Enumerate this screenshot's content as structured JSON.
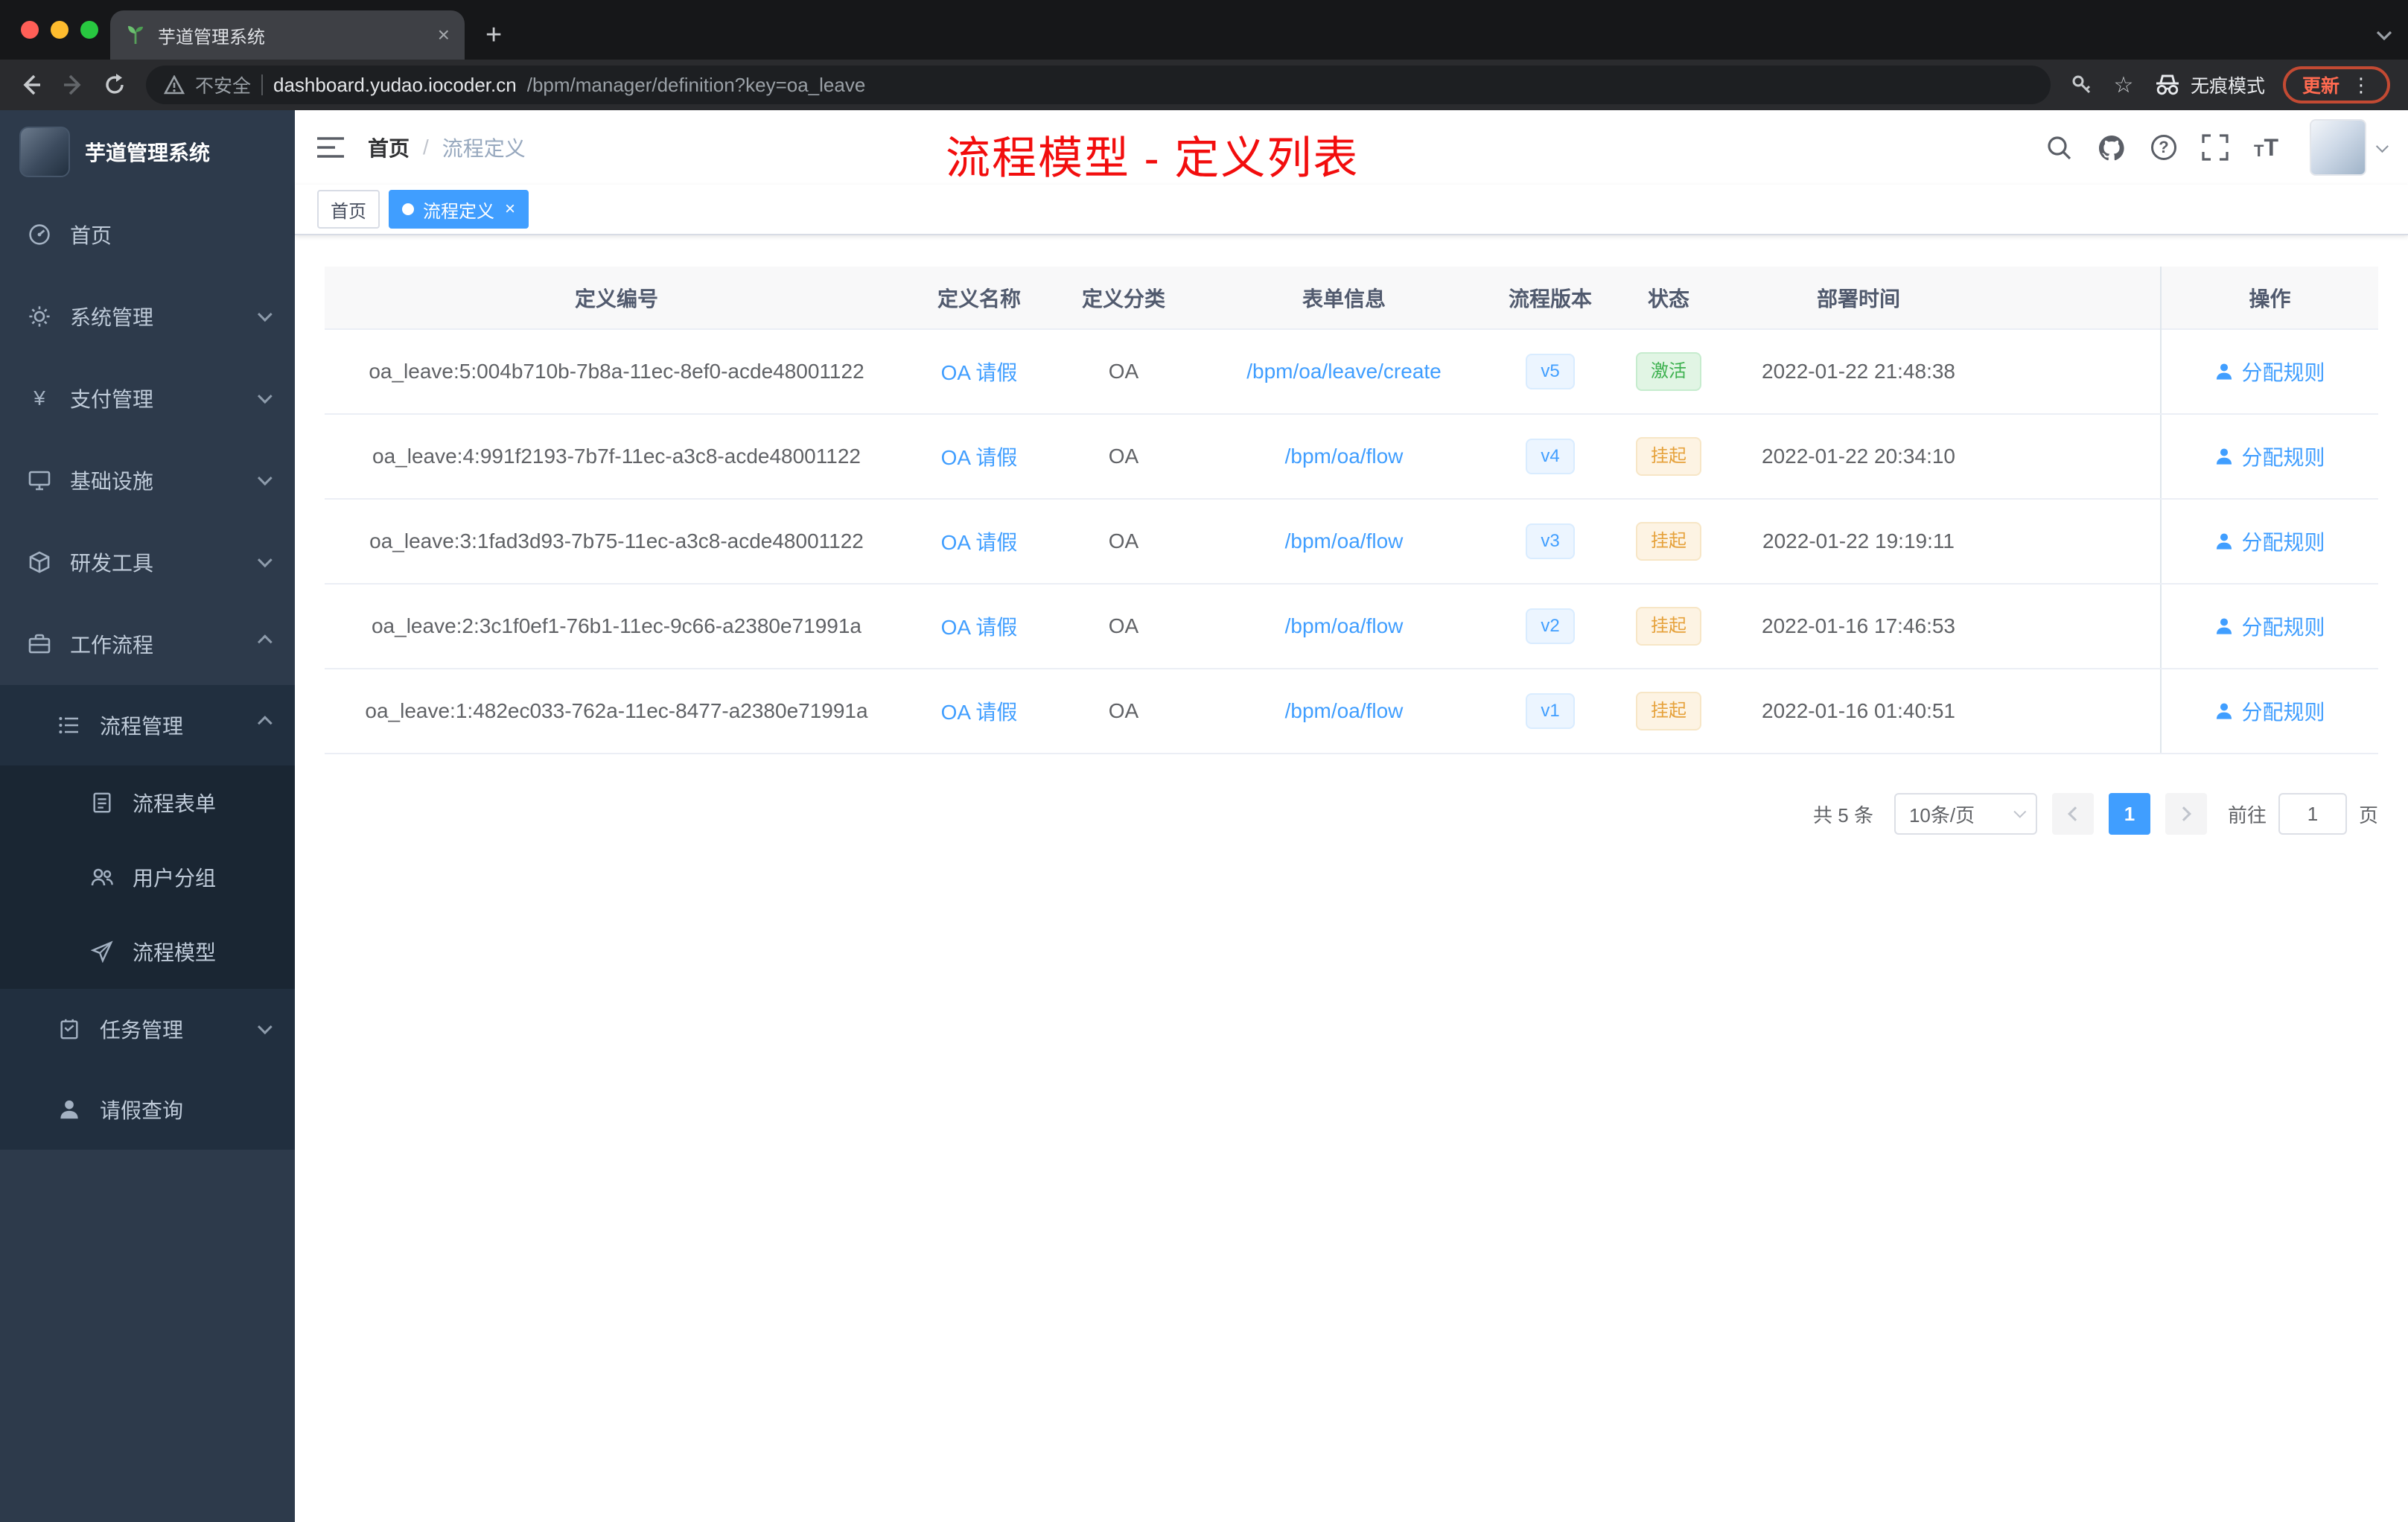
{
  "colors": {
    "accent": "#409eff",
    "success": "#3db14f",
    "warning": "#e6a23c",
    "annotation_red": "#f20d0d",
    "update_orange": "#ff6a50",
    "sidebar_bg": "#2d3a4b"
  },
  "glyphs": {
    "tab_close": "×",
    "new_tab": "+",
    "star": "☆",
    "kebab": "⋮",
    "tag_close": "×",
    "yen": "¥",
    "question": "?",
    "t_small": "T",
    "t_big": "T"
  },
  "browser": {
    "tab_title": "芋道管理系统",
    "security_label": "不安全",
    "url_host": "dashboard.yudao.iocoder.cn",
    "url_path": "/bpm/manager/definition?key=oa_leave",
    "incognito_label": "无痕模式",
    "update_label": "更新"
  },
  "sidebar": {
    "logo_title": "芋道管理系统",
    "items": [
      {
        "label": "首页"
      },
      {
        "label": "系统管理"
      },
      {
        "label": "支付管理"
      },
      {
        "label": "基础设施"
      },
      {
        "label": "研发工具"
      },
      {
        "label": "工作流程"
      },
      {
        "label": "流程管理"
      },
      {
        "label": "流程表单"
      },
      {
        "label": "用户分组"
      },
      {
        "label": "流程模型"
      },
      {
        "label": "任务管理"
      },
      {
        "label": "请假查询"
      }
    ]
  },
  "header": {
    "breadcrumb_home": "首页",
    "breadcrumb_sep": "/",
    "breadcrumb_current": "流程定义",
    "annotation": "流程模型 - 定义列表"
  },
  "tags": {
    "home": "首页",
    "active": "流程定义"
  },
  "table": {
    "columns": [
      "定义编号",
      "定义名称",
      "定义分类",
      "表单信息",
      "流程版本",
      "状态",
      "部署时间",
      "操作"
    ],
    "rows": [
      {
        "id": "oa_leave:5:004b710b-7b8a-11ec-8ef0-acde48001122",
        "name": "OA 请假",
        "category": "OA",
        "form": "/bpm/oa/leave/create",
        "version": "v5",
        "status": "激活",
        "status_type": "success",
        "deploy_time": "2022-01-22 21:48:38",
        "action": "分配规则"
      },
      {
        "id": "oa_leave:4:991f2193-7b7f-11ec-a3c8-acde48001122",
        "name": "OA 请假",
        "category": "OA",
        "form": "/bpm/oa/flow",
        "version": "v4",
        "status": "挂起",
        "status_type": "warning",
        "deploy_time": "2022-01-22 20:34:10",
        "action": "分配规则"
      },
      {
        "id": "oa_leave:3:1fad3d93-7b75-11ec-a3c8-acde48001122",
        "name": "OA 请假",
        "category": "OA",
        "form": "/bpm/oa/flow",
        "version": "v3",
        "status": "挂起",
        "status_type": "warning",
        "deploy_time": "2022-01-22 19:19:11",
        "action": "分配规则"
      },
      {
        "id": "oa_leave:2:3c1f0ef1-76b1-11ec-9c66-a2380e71991a",
        "name": "OA 请假",
        "category": "OA",
        "form": "/bpm/oa/flow",
        "version": "v2",
        "status": "挂起",
        "status_type": "warning",
        "deploy_time": "2022-01-16 17:46:53",
        "action": "分配规则"
      },
      {
        "id": "oa_leave:1:482ec033-762a-11ec-8477-a2380e71991a",
        "name": "OA 请假",
        "category": "OA",
        "form": "/bpm/oa/flow",
        "version": "v1",
        "status": "挂起",
        "status_type": "warning",
        "deploy_time": "2022-01-16 01:40:51",
        "action": "分配规则"
      }
    ]
  },
  "pagination": {
    "total": "共 5 条",
    "page_size": "10条/页",
    "current_page": "1",
    "goto_label": "前往",
    "goto_value": "1",
    "page_label": "页"
  },
  "icon_names": [
    "leaf-favicon-icon",
    "close-icon",
    "minimize-icon",
    "maximize-icon",
    "back-icon",
    "forward-icon",
    "reload-icon",
    "warning-icon",
    "key-icon",
    "star-icon",
    "incognito-icon",
    "kebab-menu-icon",
    "hamburger-icon",
    "search-icon",
    "github-icon",
    "question-icon",
    "fullscreen-icon",
    "font-size-icon",
    "caret-down-icon",
    "dashboard-icon",
    "gear-icon",
    "yen-icon",
    "monitor-icon",
    "box-icon",
    "briefcase-icon",
    "list-icon",
    "form-icon",
    "users-icon",
    "send-icon",
    "tasks-icon",
    "person-icon",
    "user-icon"
  ]
}
